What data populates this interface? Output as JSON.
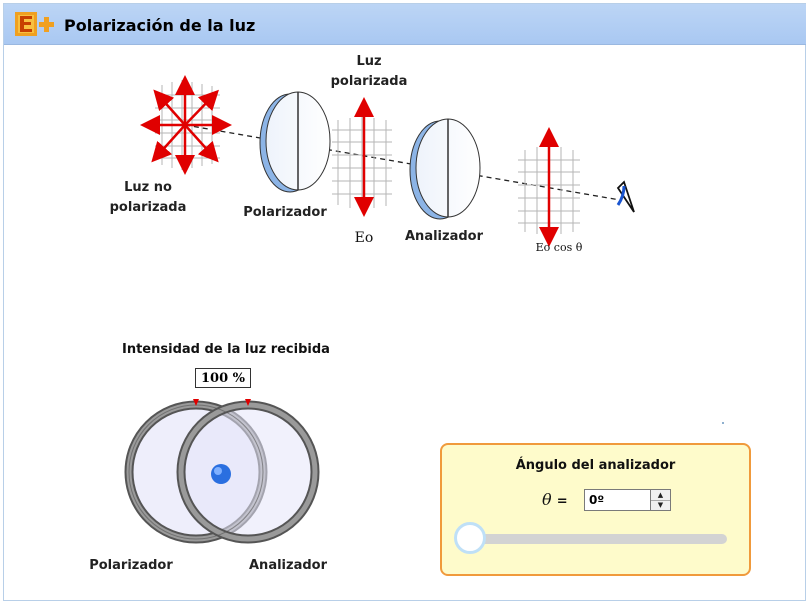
{
  "app": {
    "title": "Polarización de la luz"
  },
  "diagram": {
    "unpolarized_label": "Luz no polarizada",
    "polarizer_label": "Polarizador",
    "polarized_light_label": "Luz polarizada",
    "analyzer_label": "Analizador",
    "e0_label": "Eo",
    "e0cos_label": "Eo cos θ",
    "beam_color": "#e00000"
  },
  "intensity": {
    "title": "Intensidad de la luz recibida",
    "value": "100 %",
    "left_ring_label": "Polarizador",
    "right_ring_label": "Analizador"
  },
  "control": {
    "title": "Ángulo del analizador",
    "theta_symbol": "θ",
    "equals": "=",
    "angle_value": "0º",
    "slider_fraction": 0
  }
}
